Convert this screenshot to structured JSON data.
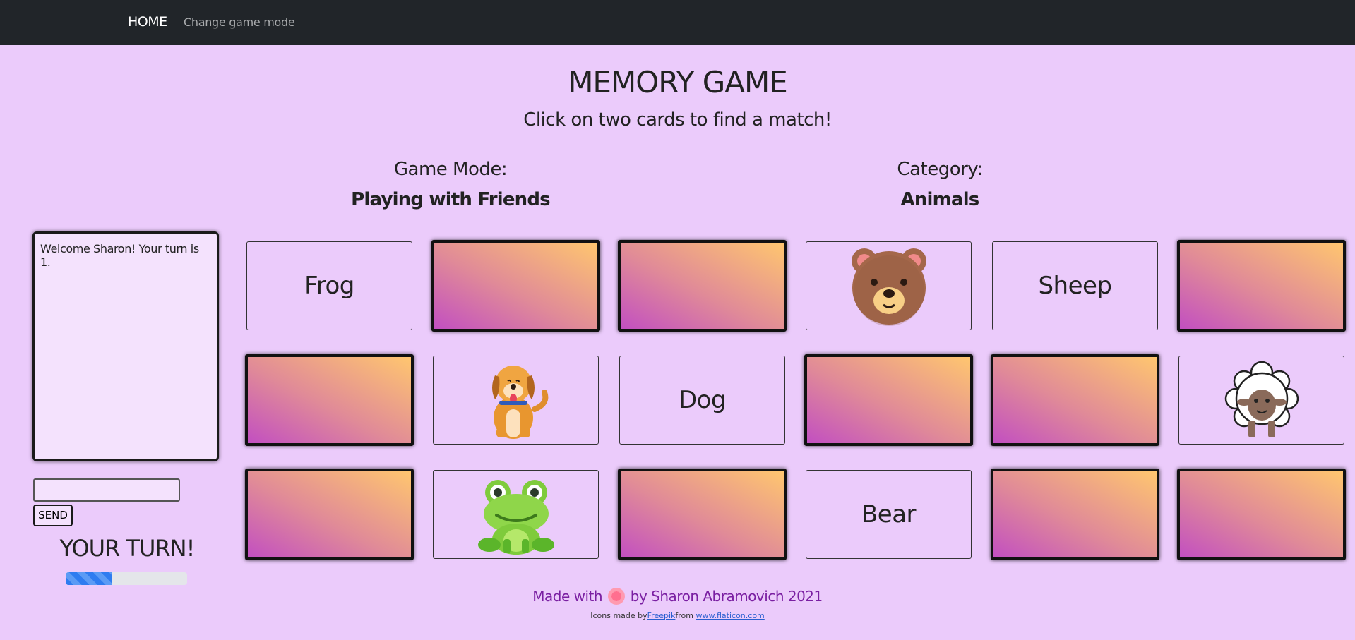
{
  "nav": {
    "home": "HOME",
    "change_mode": "Change game mode"
  },
  "header": {
    "title": "MEMORY GAME",
    "subtitle": "Click on two cards to find a match!"
  },
  "info": {
    "mode_label": "Game Mode:",
    "mode_value": "Playing with Friends",
    "category_label": "Category:",
    "category_value": "Animals"
  },
  "chat": {
    "messages": [
      "Welcome Sharon! Your turn is 1."
    ],
    "input_value": "",
    "send_label": "SEND"
  },
  "turn": {
    "label": "YOUR TURN!",
    "timer_progress_percent": 38
  },
  "cards": [
    {
      "state": "text",
      "value": "Frog"
    },
    {
      "state": "hidden"
    },
    {
      "state": "hidden"
    },
    {
      "state": "image",
      "value": "bear-icon"
    },
    {
      "state": "text",
      "value": "Sheep"
    },
    {
      "state": "hidden"
    },
    {
      "state": "hidden"
    },
    {
      "state": "image",
      "value": "dog-icon"
    },
    {
      "state": "text",
      "value": "Dog"
    },
    {
      "state": "hidden"
    },
    {
      "state": "hidden"
    },
    {
      "state": "image",
      "value": "sheep-icon"
    },
    {
      "state": "hidden"
    },
    {
      "state": "image",
      "value": "frog-icon"
    },
    {
      "state": "hidden"
    },
    {
      "state": "text",
      "value": "Bear"
    },
    {
      "state": "hidden"
    },
    {
      "state": "hidden"
    }
  ],
  "footer": {
    "made_prefix": "Made with",
    "made_suffix": "by Sharon Abramovich 2021",
    "icons_made_by": "Icons made by",
    "freepik": "Freepik",
    "from": "from",
    "flaticon": "www.flaticon.com"
  },
  "colors": {
    "background": "#ebcbfb",
    "navbar": "#212529",
    "card_gradient_start": "#c24fc1",
    "card_gradient_end": "#ffc66f",
    "footer_text": "#7a1fa2"
  }
}
